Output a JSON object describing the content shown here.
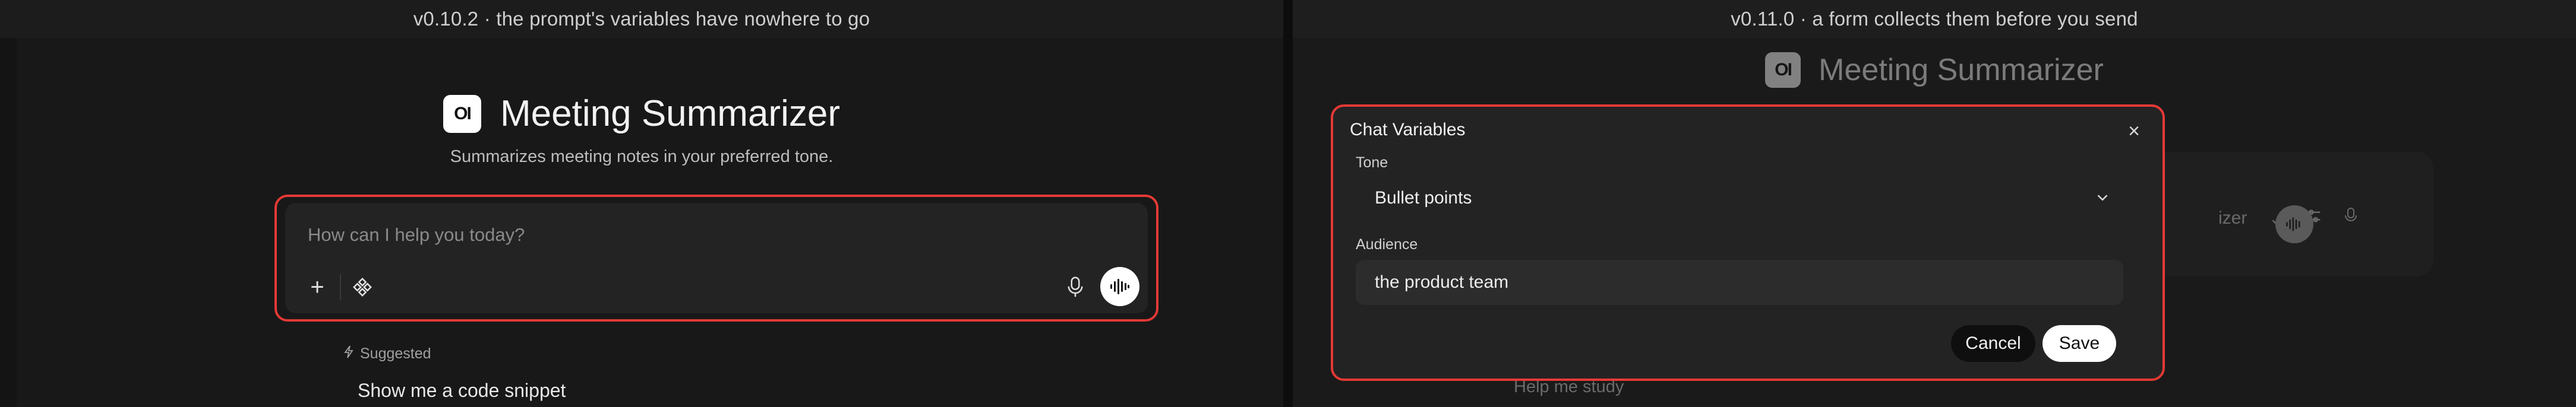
{
  "left": {
    "caption": "v0.10.2 · the prompt's variables have nowhere to go",
    "logo_text": "OI",
    "model_name": "Meeting Summarizer",
    "subtitle": "Summarizes meeting notes in your preferred tone.",
    "composer": {
      "placeholder": "How can I help you today?"
    },
    "suggested": {
      "heading": "Suggested",
      "item": "Show me a code snippet"
    }
  },
  "right": {
    "caption": "v0.11.0 · a form collects them before you send",
    "logo_text": "OI",
    "model_name": "Meeting Summarizer",
    "background_partial_text": "izer",
    "background_help": "Help me study",
    "modal": {
      "title": "Chat Variables",
      "close_symbol": "×",
      "fields": [
        {
          "label": "Tone",
          "type": "select",
          "value": "Bullet points"
        },
        {
          "label": "Audience",
          "type": "text",
          "value": "the product team"
        }
      ],
      "cancel_label": "Cancel",
      "save_label": "Save"
    }
  },
  "colors": {
    "highlight": "#e53935",
    "background": "#181818",
    "surface": "#232323"
  }
}
